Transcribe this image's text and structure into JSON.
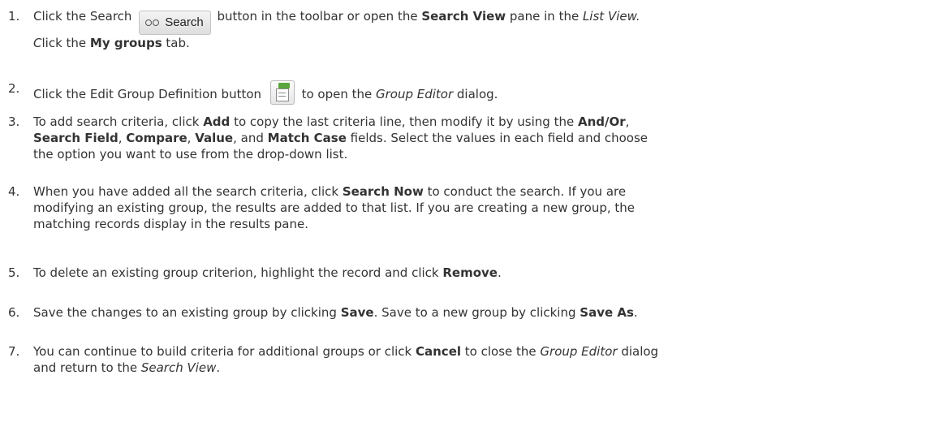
{
  "steps": [
    {
      "num": "1.",
      "line1": {
        "a": "Click the Search ",
        "icon": "Search",
        "b": " button in the toolbar or open the ",
        "c": "Search View",
        "d": " pane in the ",
        "e": "List View."
      },
      "line2": {
        "a": "C",
        "b": "lick the ",
        "c": "My groups",
        "d": " tab."
      }
    },
    {
      "num": "2.",
      "a": "Click the Edit Group Definition button ",
      "b": " to open the ",
      "c": "Group Editor",
      "d": " dialog."
    },
    {
      "num": "3.",
      "line1": {
        "a": "To add search criteria, click ",
        "b": "Add",
        "c": " to copy the last criteria line, then modify it by using the ",
        "d": "And/Or",
        "e": ","
      },
      "line2": {
        "a": "Search Field",
        "b": ", ",
        "c": "Compare",
        "d": ", ",
        "e": "Value",
        "f": ", and ",
        "g": "Match Case",
        "h": " fields. Select the values in each field and choose"
      },
      "line3": "the option you want to use from the drop-down list."
    },
    {
      "num": "4.",
      "line1": {
        "a": "When you have added all the search criteria, click ",
        "b": "Search Now",
        "c": " to conduct the search. If you are"
      },
      "line2": "modifying an existing group, the results are added to that list. If you are creating a new group, the",
      "line3": "matching records display in the results pane."
    },
    {
      "num": "5.",
      "a": "To delete an existing group criterion, highlight the record and click ",
      "b": "Remove",
      "c": "."
    },
    {
      "num": "6.",
      "a": "Save the changes to an existing group by clicking ",
      "b": "Save",
      "c": ". Save to a new group by clicking ",
      "d": "Save As",
      "e": "."
    },
    {
      "num": "7.",
      "line1": {
        "a": "You can continue to build criteria for additional groups or click ",
        "b": "Cancel",
        "c": " to close the ",
        "d": "Group Editor",
        "e": " dialog"
      },
      "line2": {
        "a": "and return to the ",
        "b": "Search View",
        "c": "."
      }
    }
  ],
  "icons": {
    "search_button": "binoculars-icon",
    "edit_group_button": "edit-group-definition-icon",
    "accent": "#5aa53c"
  }
}
